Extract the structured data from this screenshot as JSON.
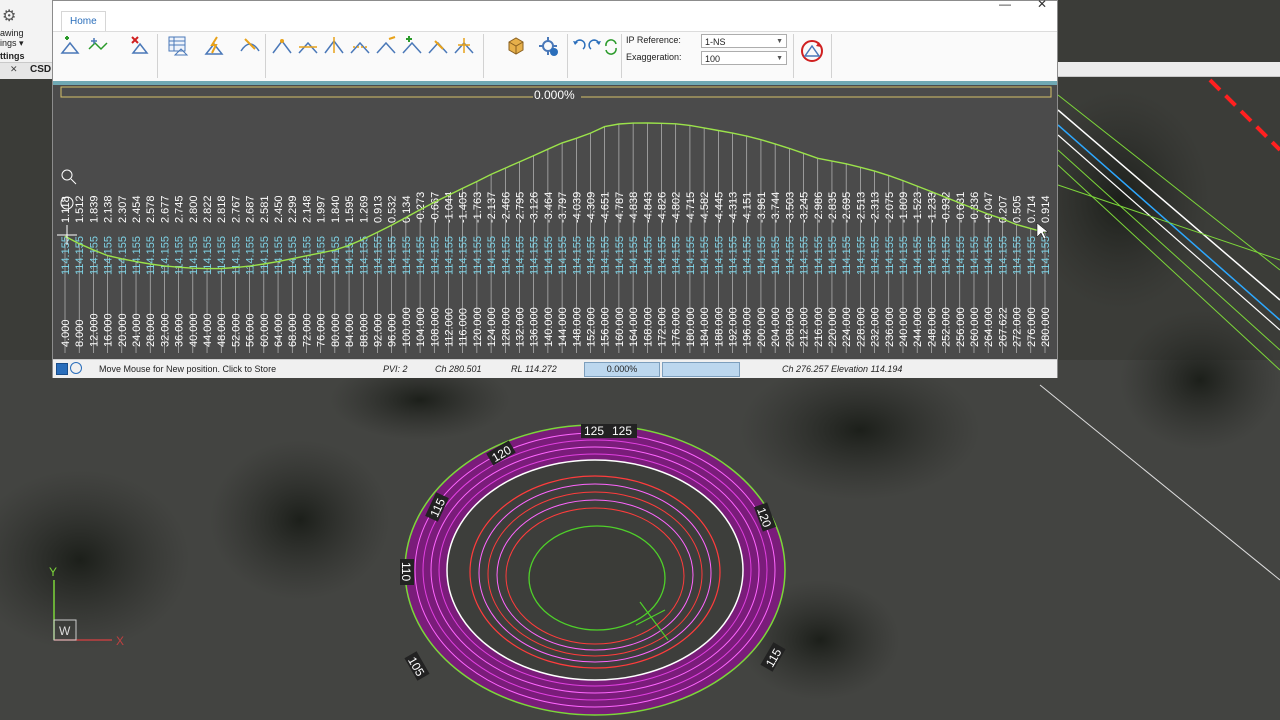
{
  "app": {
    "window_title": "",
    "tab_home": "Home"
  },
  "cad": {
    "ribbon_label_1": "awing",
    "ribbon_label_2": "ings ▾",
    "ribbon_label_3": "ttings",
    "tab_close": "✕",
    "tab_name": "CSD",
    "axis_x": "X",
    "axis_y": "Y",
    "axis_w": "W",
    "contour_labels": [
      "125",
      "125",
      "120",
      "120",
      "115",
      "110",
      "105",
      "115"
    ]
  },
  "toolbar": {
    "ip_reference_label": "IP Reference:",
    "ip_reference_value": "1-NS",
    "exaggeration_label": "Exaggeration:",
    "exaggeration_value": "100"
  },
  "profile": {
    "grade_label": "0.000%",
    "cut_fill": [
      "1.118",
      "1.512",
      "1.839",
      "2.138",
      "2.307",
      "2.454",
      "2.578",
      "2.677",
      "2.745",
      "2.800",
      "2.822",
      "2.818",
      "2.767",
      "2.687",
      "2.581",
      "2.450",
      "2.299",
      "2.148",
      "1.997",
      "1.840",
      "1.595",
      "1.269",
      "0.913",
      "0.532",
      "0.134",
      "-0.273",
      "-0.667",
      "-1.044",
      "-1.405",
      "-1.763",
      "-2.137",
      "-2.466",
      "-2.795",
      "-3.126",
      "-3.464",
      "-3.797",
      "-4.039",
      "-4.309",
      "-4.651",
      "-4.787",
      "-4.838",
      "-4.843",
      "-4.826",
      "-4.802",
      "-4.715",
      "-4.582",
      "-4.445",
      "-4.313",
      "-4.151",
      "-3.961",
      "-3.744",
      "-3.503",
      "-3.245",
      "-2.986",
      "-2.835",
      "-2.695",
      "-2.513",
      "-2.313",
      "-2.075",
      "-1.809",
      "-1.523",
      "-1.233",
      "-0.932",
      "-0.631",
      "-0.336",
      "-0.047",
      "0.207",
      "0.505",
      "0.714",
      "0.914"
    ],
    "design_level": "114.155",
    "chainages": [
      "4.000",
      "8.000",
      "12.000",
      "16.000",
      "20.000",
      "24.000",
      "28.000",
      "32.000",
      "36.000",
      "40.000",
      "44.000",
      "48.000",
      "52.000",
      "56.000",
      "60.000",
      "64.000",
      "68.000",
      "72.000",
      "76.000",
      "80.000",
      "84.000",
      "88.000",
      "92.000",
      "96.000",
      "100.000",
      "104.000",
      "108.000",
      "112.000",
      "116.000",
      "120.000",
      "124.000",
      "128.000",
      "132.000",
      "136.000",
      "140.000",
      "144.000",
      "148.000",
      "152.000",
      "156.000",
      "160.000",
      "164.000",
      "168.000",
      "172.000",
      "176.000",
      "180.000",
      "184.000",
      "188.000",
      "192.000",
      "196.000",
      "200.000",
      "204.000",
      "208.000",
      "212.000",
      "216.000",
      "220.000",
      "224.000",
      "228.000",
      "232.000",
      "236.000",
      "240.000",
      "244.000",
      "248.000",
      "252.000",
      "256.000",
      "260.000",
      "264.000",
      "267.622",
      "272.000",
      "276.000",
      "280.000"
    ]
  },
  "status": {
    "message": "Move Mouse for New position. Click to Store",
    "pvi": "PVI: 2",
    "chainage": "Ch 280.501",
    "rl": "RL 114.272",
    "grade": "0.000%",
    "cursor_readout": "Ch 276.257 Elevation 114.194"
  }
}
